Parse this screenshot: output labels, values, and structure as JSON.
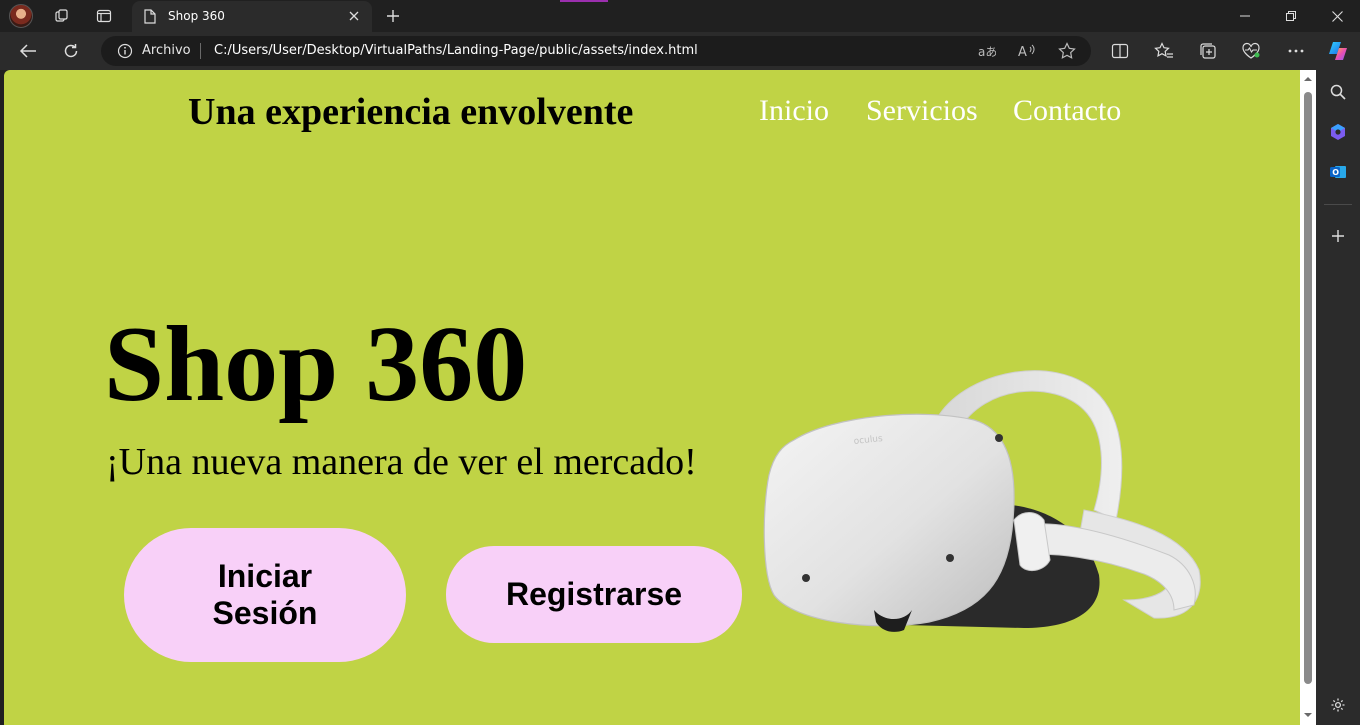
{
  "browser": {
    "tab_title": "Shop 360",
    "address_scheme_label": "Archivo",
    "url": "C:/Users/User/Desktop/VirtualPaths/Landing-Page/public/assets/index.html"
  },
  "icons": [
    "profile-avatar",
    "workspaces-icon",
    "tab-actions-icon",
    "page-icon",
    "close-icon",
    "plus-icon",
    "minimize-icon",
    "restore-icon",
    "back-icon",
    "refresh-icon",
    "info-icon",
    "translate-icon",
    "read-aloud-icon",
    "star-icon",
    "split-screen-icon",
    "favorites-icon",
    "collections-icon",
    "browser-essentials-icon",
    "more-icon",
    "copilot-icon",
    "search-icon",
    "outlook-icon",
    "settings-icon"
  ],
  "page": {
    "site_title": "Una experiencia envolvente",
    "nav": [
      "Inicio",
      "Servicios",
      "Contacto"
    ],
    "hero_title": "Shop 360",
    "hero_subtitle": "¡Una nueva manera de ver el mercado!",
    "login_button": "Iniciar Sesión",
    "register_button": "Registrarse",
    "hero_image": "vr-headset"
  },
  "colors": {
    "page_background": "#c0d345",
    "button_background": "#f8d0f8",
    "nav_link": "#ffffff",
    "browser_frame": "#202020"
  }
}
